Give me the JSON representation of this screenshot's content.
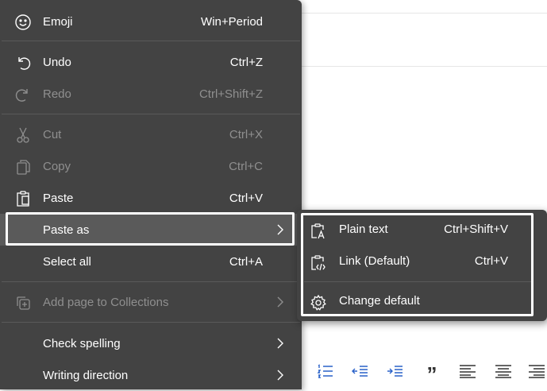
{
  "context_menu": {
    "items": [
      {
        "id": "emoji",
        "label": "Emoji",
        "shortcut": "Win+Period",
        "icon": "smiley-icon",
        "enabled": true
      },
      {
        "id": "undo",
        "label": "Undo",
        "shortcut": "Ctrl+Z",
        "icon": "undo-icon",
        "enabled": true
      },
      {
        "id": "redo",
        "label": "Redo",
        "shortcut": "Ctrl+Shift+Z",
        "icon": "redo-icon",
        "enabled": false
      },
      {
        "id": "cut",
        "label": "Cut",
        "shortcut": "Ctrl+X",
        "icon": "scissors-icon",
        "enabled": false
      },
      {
        "id": "copy",
        "label": "Copy",
        "shortcut": "Ctrl+C",
        "icon": "copy-icon",
        "enabled": false
      },
      {
        "id": "paste",
        "label": "Paste",
        "shortcut": "Ctrl+V",
        "icon": "clipboard-icon",
        "enabled": true
      },
      {
        "id": "paste_as",
        "label": "Paste as",
        "shortcut": "",
        "icon": "",
        "enabled": true,
        "has_submenu": true,
        "highlighted": true
      },
      {
        "id": "select_all",
        "label": "Select all",
        "shortcut": "Ctrl+A",
        "icon": "",
        "enabled": true
      },
      {
        "id": "add_to_collections",
        "label": "Add page to Collections",
        "shortcut": "",
        "icon": "collections-icon",
        "enabled": false,
        "has_submenu": true
      },
      {
        "id": "check_spelling",
        "label": "Check spelling",
        "shortcut": "",
        "icon": "",
        "enabled": true,
        "has_submenu": true
      },
      {
        "id": "writing_direction",
        "label": "Writing direction",
        "shortcut": "",
        "icon": "",
        "enabled": true,
        "has_submenu": true
      }
    ]
  },
  "paste_as_submenu": {
    "items": [
      {
        "id": "plain_text",
        "label": "Plain text",
        "shortcut": "Ctrl+Shift+V",
        "icon": "clipboard-text-icon"
      },
      {
        "id": "link_default",
        "label": "Link (Default)",
        "shortcut": "Ctrl+V",
        "icon": "clipboard-code-icon"
      },
      {
        "id": "change_default",
        "label": "Change default",
        "shortcut": "",
        "icon": "gear-icon"
      }
    ]
  },
  "toolbar": {
    "icons": [
      "numbered-list-icon",
      "decrease-indent-icon",
      "increase-indent-icon",
      "quote-icon",
      "align-left-icon",
      "align-center-icon",
      "align-right-icon"
    ],
    "quote_glyph": "”"
  },
  "colors": {
    "menu_bg": "#434343",
    "highlight_bg": "#5a5a5a",
    "separator": "#5a5a5a",
    "text": "#ffffff",
    "disabled_text": "#8f8f8f",
    "callout_border": "#ffffff"
  }
}
